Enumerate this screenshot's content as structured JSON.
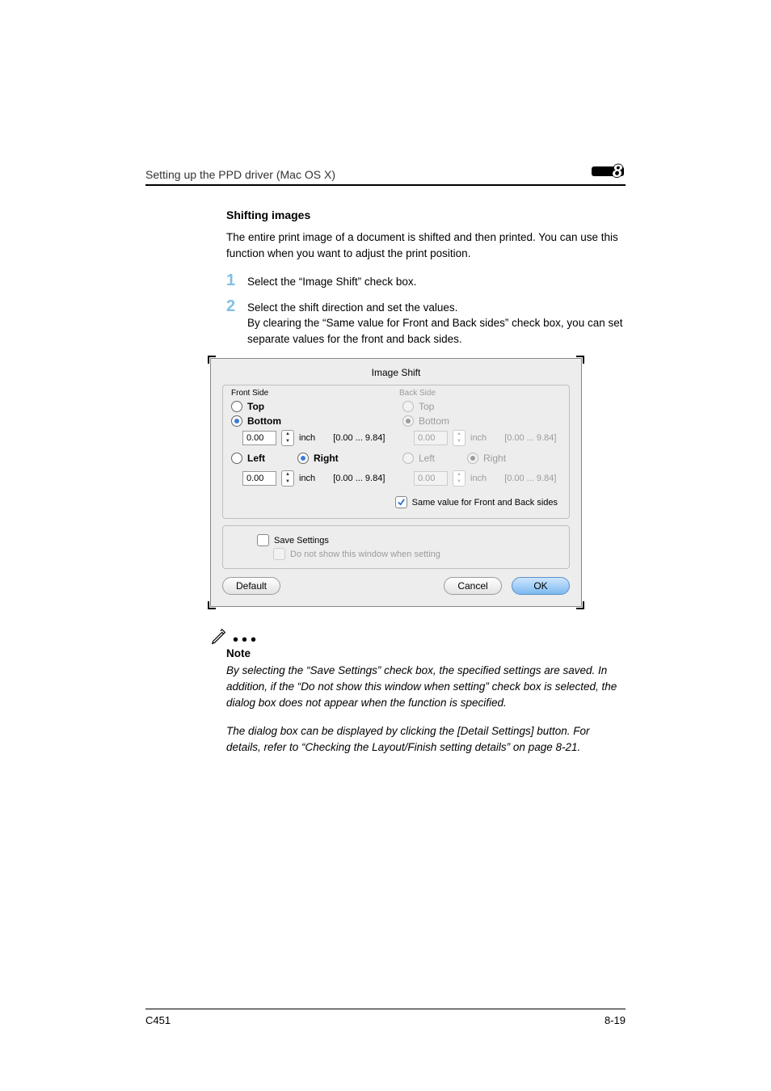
{
  "header": {
    "breadcrumb": "Setting up the PPD driver (Mac OS X)",
    "chapter": "8"
  },
  "section": {
    "title": "Shifting images"
  },
  "intro": "The entire print image of a document is shifted and then printed. You can use this function when you want to adjust the print position.",
  "steps": [
    {
      "num": "1",
      "text": "Select the “Image Shift” check box."
    },
    {
      "num": "2",
      "text": "Select the shift direction and set the values.\nBy clearing the “Same value for Front and Back sides” check box, you can set separate values for the front and back sides."
    }
  ],
  "dialog": {
    "title": "Image Shift",
    "front": {
      "legend": "Front Side",
      "top": "Top",
      "bottom": "Bottom",
      "vert_sel": "bottom",
      "vert_value": "0.00",
      "unit": "inch",
      "range": "[0.00 ... 9.84]",
      "left": "Left",
      "right": "Right",
      "horiz_sel": "right",
      "horiz_value": "0.00"
    },
    "back": {
      "legend": "Back Side",
      "top": "Top",
      "bottom": "Bottom",
      "vert_sel": "bottom",
      "vert_value": "0.00",
      "unit": "inch",
      "range": "[0.00 ... 9.84]",
      "left": "Left",
      "right": "Right",
      "horiz_sel": "right",
      "horiz_value": "0.00"
    },
    "same_label": "Same value for Front and Back sides",
    "same_checked": true,
    "save_label": "Save Settings",
    "save_checked": false,
    "dont_show_label": "Do not show this window when setting",
    "dont_show_checked": false,
    "buttons": {
      "default": "Default",
      "cancel": "Cancel",
      "ok": "OK"
    }
  },
  "note": {
    "heading": "Note",
    "p1": "By selecting the “Save Settings” check box, the specified settings are saved. In addition, if the “Do not show this window when setting” check box is selected, the dialog box does not appear when the function is specified.",
    "p2": "The dialog box can be displayed by clicking the [Detail Settings] button. For details, refer to “Checking the Layout/Finish setting details” on page 8-21."
  },
  "footer": {
    "model": "C451",
    "page": "8-19"
  }
}
